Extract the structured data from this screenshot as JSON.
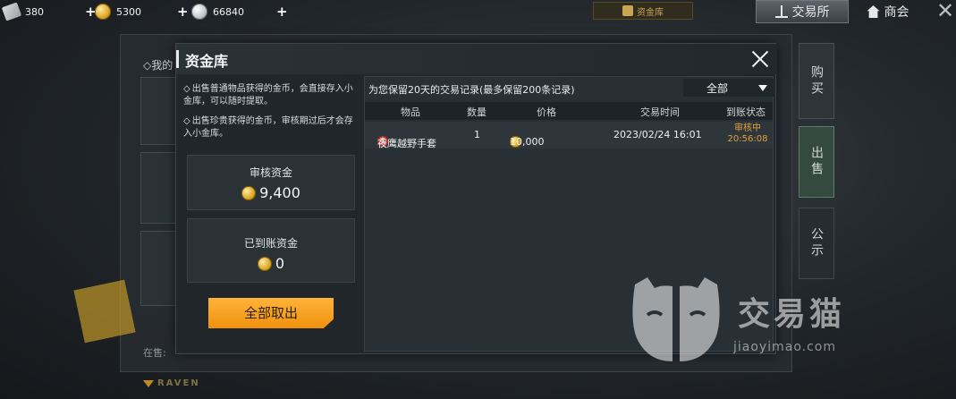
{
  "resources": {
    "ticket": "380",
    "gold": "5300",
    "silver": "66840",
    "plus": "+"
  },
  "top": {
    "vault_pill": "资金库",
    "exchange_tab": "交易所",
    "shop_tab": "商会",
    "close": "✕"
  },
  "background": {
    "title": "◇我的",
    "footer": "在售:",
    "side_buy": "购买",
    "side_sell": "出售",
    "side_notice": "公示",
    "brand": "RAVEN"
  },
  "modal": {
    "title": "资金库",
    "notes": [
      "出售普通物品获得的金币，会直接存入小金库，可以随时提取。",
      "出售珍贵获得的金币，审核期过后才会存入小金库。"
    ],
    "review_funds_label": "审核资金",
    "review_funds_value": "9,400",
    "settled_funds_label": "已到账资金",
    "settled_funds_value": "0",
    "withdraw_button": "全部取出",
    "records_note": "为您保留20天的交易记录(最多保留200条记录)",
    "filter_selected": "全部",
    "columns": [
      "物品",
      "数量",
      "价格",
      "交易时间",
      "到账状态"
    ],
    "rows": [
      {
        "tag": "卖",
        "item": "夜鹰越野手套",
        "qty": "1",
        "price": "10,000",
        "time": "2023/02/24  16:01",
        "status": "审核中",
        "countdown": "20:56:08"
      }
    ]
  },
  "watermark": {
    "text": "交易猫",
    "url": "jiaoyimao.com"
  },
  "colors": {
    "accent_orange": "#f0920c",
    "status_orange": "#e2a03a",
    "sell_tag_red": "#b8322b",
    "sell_tab_green": "#344a41"
  }
}
